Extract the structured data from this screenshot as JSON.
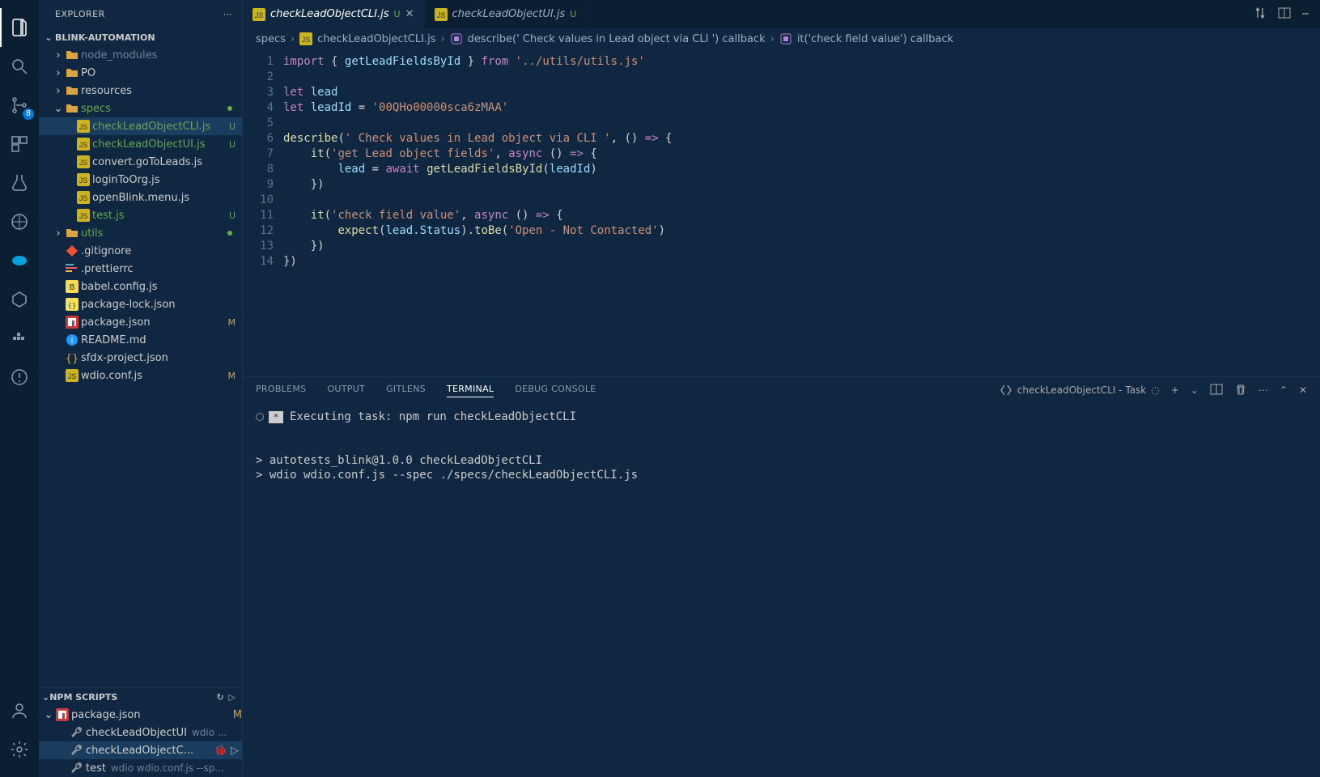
{
  "sidebar": {
    "title": "EXPLORER",
    "folder": "BLINK-AUTOMATION",
    "scm_badge": "8",
    "tree": [
      {
        "indent": 0,
        "chev": ">",
        "icon": "folder",
        "name": "node_modules",
        "status": "",
        "cls": "dim"
      },
      {
        "indent": 0,
        "chev": ">",
        "icon": "folder",
        "name": "PO",
        "status": ""
      },
      {
        "indent": 0,
        "chev": ">",
        "icon": "folder",
        "name": "resources",
        "status": ""
      },
      {
        "indent": 0,
        "chev": "v",
        "icon": "folder-open",
        "name": "specs",
        "status": "",
        "dot": true,
        "untracked": true
      },
      {
        "indent": 1,
        "chev": "",
        "icon": "js",
        "name": "checkLeadObjectCLI.js",
        "status": "U",
        "selected": true,
        "untracked": true
      },
      {
        "indent": 1,
        "chev": "",
        "icon": "js",
        "name": "checkLeadObjectUI.js",
        "status": "U",
        "untracked": true
      },
      {
        "indent": 1,
        "chev": "",
        "icon": "js",
        "name": "convert.goToLeads.js",
        "status": ""
      },
      {
        "indent": 1,
        "chev": "",
        "icon": "js",
        "name": "loginToOrg.js",
        "status": ""
      },
      {
        "indent": 1,
        "chev": "",
        "icon": "js",
        "name": "openBlink.menu.js",
        "status": ""
      },
      {
        "indent": 1,
        "chev": "",
        "icon": "js",
        "name": "test.js",
        "status": "U",
        "untracked": true
      },
      {
        "indent": 0,
        "chev": ">",
        "icon": "folder",
        "name": "utils",
        "status": "",
        "dot": true,
        "untracked": true
      },
      {
        "indent": 0,
        "chev": "",
        "icon": "git",
        "name": ".gitignore",
        "status": ""
      },
      {
        "indent": 0,
        "chev": "",
        "icon": "prettier",
        "name": ".prettierrc",
        "status": ""
      },
      {
        "indent": 0,
        "chev": "",
        "icon": "babel",
        "name": "babel.config.js",
        "status": ""
      },
      {
        "indent": 0,
        "chev": "",
        "icon": "json",
        "name": "package-lock.json",
        "status": ""
      },
      {
        "indent": 0,
        "chev": "",
        "icon": "npm",
        "name": "package.json",
        "status": "M",
        "modified": true
      },
      {
        "indent": 0,
        "chev": "",
        "icon": "info",
        "name": "README.md",
        "status": ""
      },
      {
        "indent": 0,
        "chev": "",
        "icon": "json-braces",
        "name": "sfdx-project.json",
        "status": ""
      },
      {
        "indent": 0,
        "chev": "",
        "icon": "js",
        "name": "wdio.conf.js",
        "status": "M",
        "modified": true
      }
    ],
    "npm": {
      "title": "NPM SCRIPTS",
      "pkg": {
        "name": "package.json",
        "status": "M"
      },
      "scripts": [
        {
          "name": "checkLeadObjectUI",
          "sub": "wdio ..."
        },
        {
          "name": "checkLeadObjectC...",
          "sub": "",
          "selected": true,
          "actions": true
        },
        {
          "name": "test",
          "sub": "wdio wdio.conf.js --sp..."
        }
      ]
    }
  },
  "tabs": [
    {
      "name": "checkLeadObjectCLI.js",
      "status": "U",
      "active": true,
      "close": true
    },
    {
      "name": "checkLeadObjectUI.js",
      "status": "U",
      "active": false,
      "close": false
    }
  ],
  "breadcrumbs": [
    {
      "icon": "",
      "label": "specs"
    },
    {
      "icon": "js",
      "label": "checkLeadObjectCLI.js"
    },
    {
      "icon": "symbol",
      "label": "describe(' Check values in Lead object via CLI ') callback"
    },
    {
      "icon": "symbol",
      "label": "it('check field value') callback"
    }
  ],
  "code": {
    "lines": [
      {
        "n": 1,
        "html": "<span class='kw'>import</span> <span class='punc'>{</span> <span class='var'>getLeadFieldsById</span> <span class='punc'>}</span> <span class='kw'>from</span> <span class='str'>'../utils/utils.js'</span>"
      },
      {
        "n": 2,
        "html": ""
      },
      {
        "n": 3,
        "html": "<span class='kw'>let</span> <span class='var'>lead</span>"
      },
      {
        "n": 4,
        "html": "<span class='kw'>let</span> <span class='var'>leadId</span> <span class='punc'>=</span> <span class='str'>'00QHo00000sca6zMAA'</span>"
      },
      {
        "n": 5,
        "html": ""
      },
      {
        "n": 6,
        "html": "<span class='fn'>describe</span><span class='punc'>(</span><span class='str'>' Check values in Lead object via CLI '</span><span class='punc'>, () </span><span class='kw'>=&gt;</span><span class='punc'> {</span>"
      },
      {
        "n": 7,
        "html": "    <span class='fn'>it</span><span class='punc'>(</span><span class='str'>'get Lead object fields'</span><span class='punc'>, </span><span class='kw'>async</span><span class='punc'> () </span><span class='kw'>=&gt;</span><span class='punc'> {</span>"
      },
      {
        "n": 8,
        "html": "        <span class='var'>lead</span> <span class='punc'>=</span> <span class='kw'>await</span> <span class='fn'>getLeadFieldsById</span><span class='punc'>(</span><span class='var'>leadId</span><span class='punc'>)</span>"
      },
      {
        "n": 9,
        "html": "    <span class='punc'>})</span>"
      },
      {
        "n": 10,
        "html": ""
      },
      {
        "n": 11,
        "html": "    <span class='fn'>it</span><span class='punc'>(</span><span class='str'>'check field value'</span><span class='punc'>, </span><span class='kw'>async</span><span class='punc'> () </span><span class='kw'>=&gt;</span><span class='punc'> {</span>"
      },
      {
        "n": 12,
        "html": "        <span class='fn'>expect</span><span class='punc'>(</span><span class='var'>lead</span><span class='punc'>.</span><span class='var'>Status</span><span class='punc'>).</span><span class='fn'>toBe</span><span class='punc'>(</span><span class='str'>'Open - Not Contacted'</span><span class='punc'>)</span>"
      },
      {
        "n": 13,
        "html": "    <span class='punc'>})</span>"
      },
      {
        "n": 14,
        "html": "<span class='punc'>})</span>"
      }
    ]
  },
  "panel": {
    "tabs": [
      "PROBLEMS",
      "OUTPUT",
      "GITLENS",
      "TERMINAL",
      "DEBUG CONSOLE"
    ],
    "active": "TERMINAL",
    "task_label": "checkLeadObjectCLI - Task",
    "lines": [
      {
        "prefix": "exec",
        "text": "Executing task: npm run checkLeadObjectCLI "
      },
      {
        "text": ""
      },
      {
        "text": ""
      },
      {
        "text": "> autotests_blink@1.0.0 checkLeadObjectCLI"
      },
      {
        "text": "> wdio wdio.conf.js --spec ./specs/checkLeadObjectCLI.js"
      }
    ]
  }
}
